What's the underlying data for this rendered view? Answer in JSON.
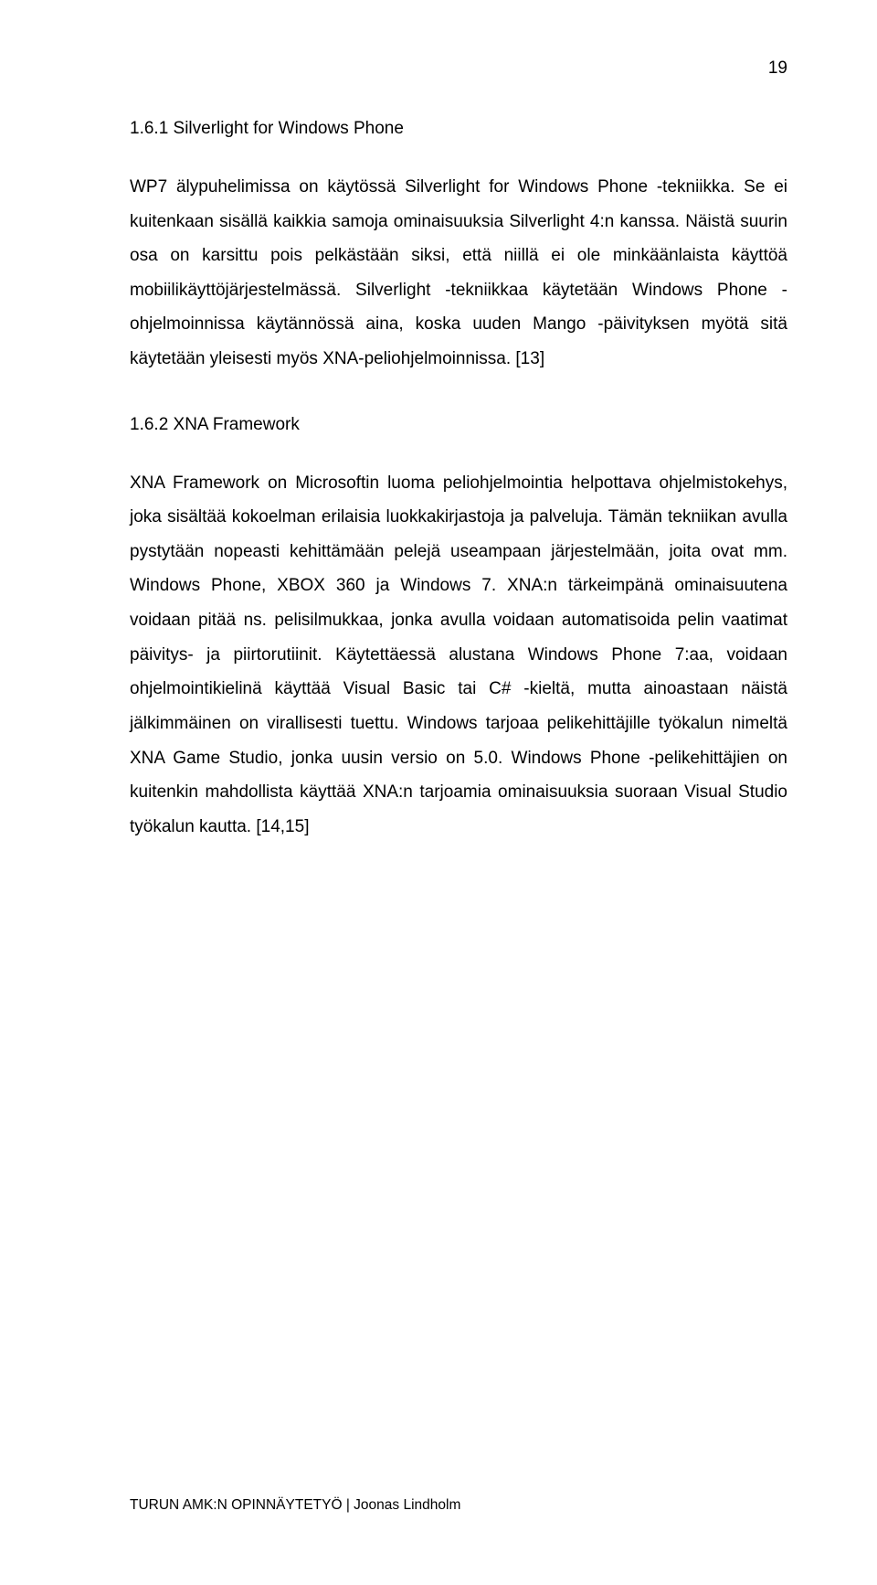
{
  "page_number": "19",
  "section_1": {
    "heading": "1.6.1 Silverlight for Windows Phone",
    "paragraph": "WP7 älypuhelimissa on käytössä Silverlight for Windows Phone -tekniikka. Se ei kuitenkaan sisällä kaikkia samoja ominaisuuksia Silverlight 4:n kanssa. Näistä suurin osa on karsittu pois pelkästään siksi, että niillä ei ole minkäänlaista käyttöä mobiilikäyttöjärjestelmässä. Silverlight -tekniikkaa käytetään Windows Phone -ohjelmoinnissa käytännössä aina, koska uuden Mango -päivityksen myötä sitä käytetään yleisesti myös XNA-peliohjelmoinnissa. [13]"
  },
  "section_2": {
    "heading": "1.6.2 XNA Framework",
    "paragraph": "XNA Framework on Microsoftin luoma peliohjelmointia helpottava ohjelmistokehys, joka sisältää kokoelman erilaisia luokkakirjastoja ja palveluja. Tämän tekniikan avulla pystytään nopeasti kehittämään pelejä useampaan järjestelmään, joita ovat mm. Windows Phone, XBOX 360 ja Windows 7. XNA:n tärkeimpänä ominaisuutena voidaan pitää ns. pelisilmukkaa, jonka avulla voidaan automatisoida pelin vaatimat päivitys- ja piirtorutiinit. Käytettäessä alustana Windows Phone 7:aa, voidaan ohjelmointikielinä käyttää Visual Basic tai C# -kieltä, mutta ainoastaan näistä jälkimmäinen on virallisesti tuettu. Windows tarjoaa pelikehittäjille työkalun nimeltä XNA Game Studio, jonka uusin versio on 5.0. Windows Phone -pelikehittäjien on kuitenkin mahdollista käyttää XNA:n tarjoamia ominaisuuksia suoraan Visual Studio työkalun kautta. [14,15]"
  },
  "footer": "TURUN AMK:N OPINNÄYTETYÖ | Joonas Lindholm"
}
